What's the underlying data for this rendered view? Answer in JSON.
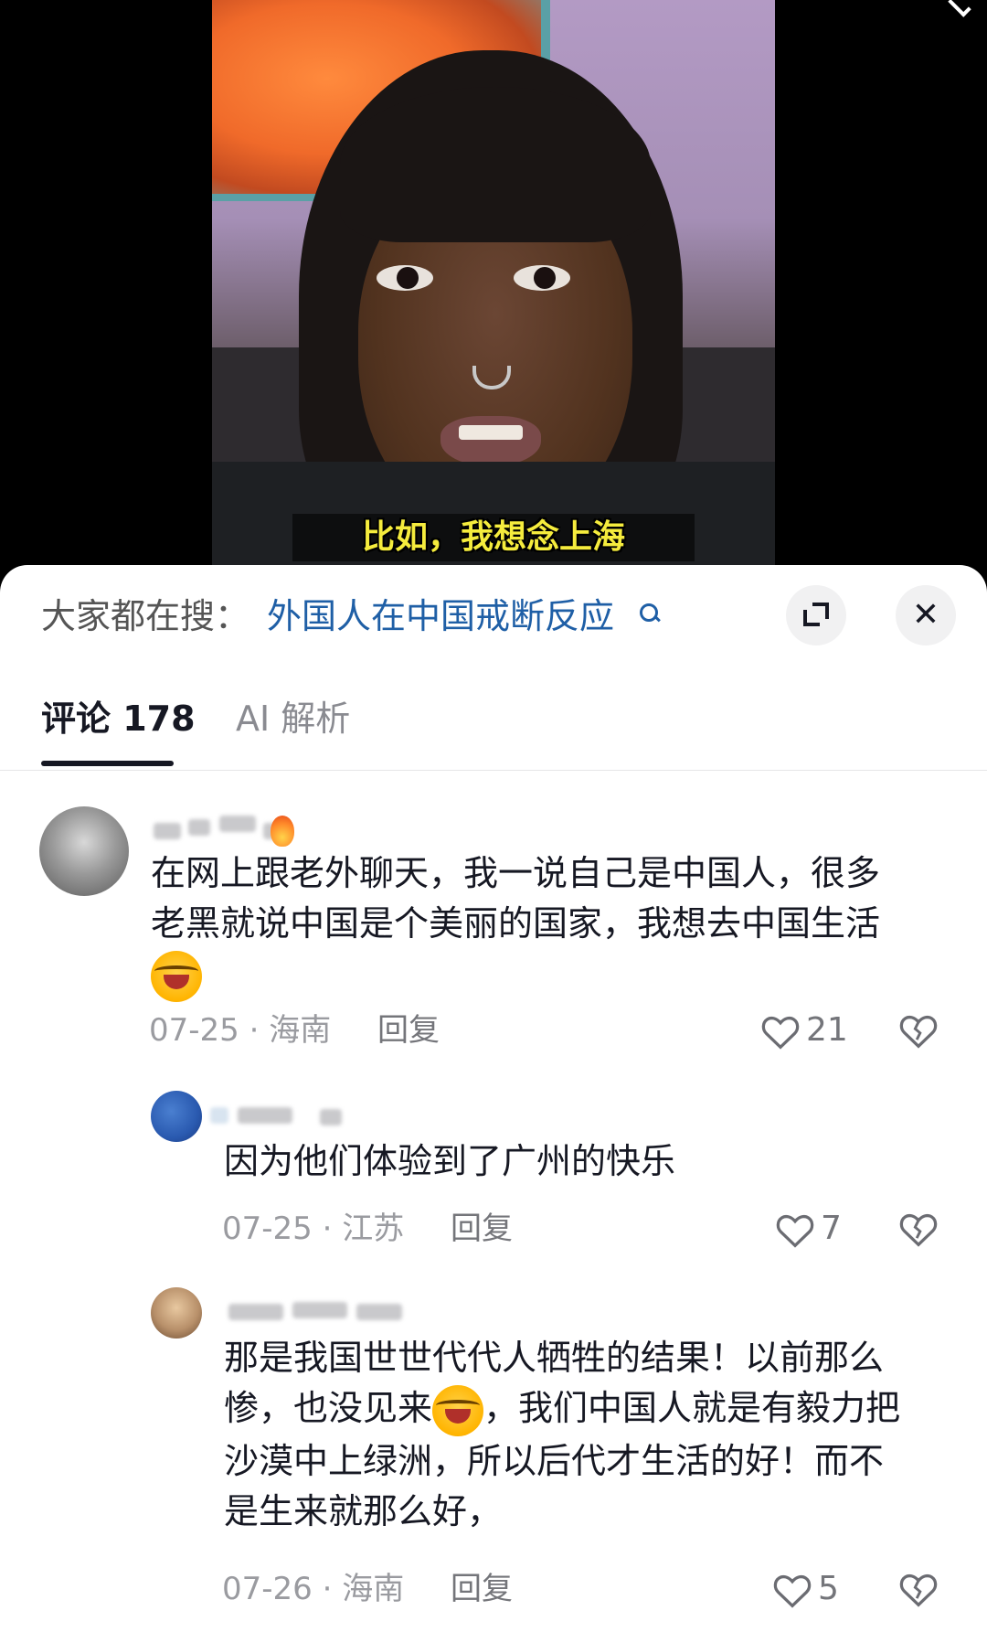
{
  "video": {
    "subtitle": "比如，我想念上海"
  },
  "panel": {
    "search_prefix": "大家都在搜：",
    "search_link": "外国人在中国戒断反应",
    "close_label": "✕",
    "tabs": [
      {
        "label": "评论 178"
      },
      {
        "label": "AI 解析"
      }
    ]
  },
  "comments": [
    {
      "text_lines": [
        "在网上跟老外聊天，我一说自己是中国人，很多",
        "老黑就说中国是个美丽的国家，我想去中国生活"
      ],
      "date": "07-25",
      "location": "海南",
      "reply_label": "回复",
      "likes": "21"
    },
    {
      "text_lines": [
        "因为他们体验到了广州的快乐"
      ],
      "date": "07-25",
      "location": "江苏",
      "reply_label": "回复",
      "likes": "7"
    },
    {
      "text_lines": [
        "那是我国世世代代人牺牲的结果！以前那么",
        "惨，也没见来",
        "，我们中国人就是有毅力把",
        "沙漠中上绿洲，所以后代才生活的好！而不",
        "是生来就那么好，"
      ],
      "date": "07-26",
      "location": "海南",
      "reply_label": "回复",
      "likes": "5"
    }
  ],
  "icons": {
    "like": "heart-outline-icon",
    "dislike": "broken-heart-icon",
    "emoji": "laughing-crying-emoji",
    "fire": "fire-icon"
  }
}
